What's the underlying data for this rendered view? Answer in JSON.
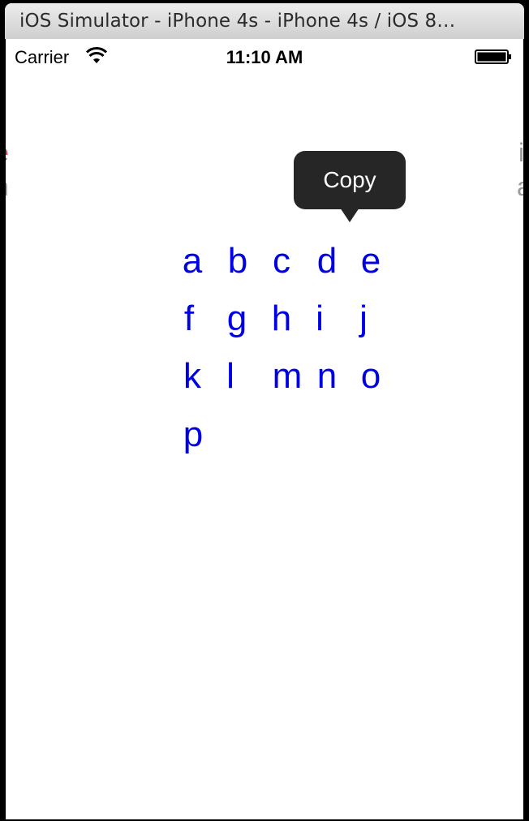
{
  "window": {
    "title": "iOS Simulator - iPhone 4s - iPhone 4s / iOS 8…"
  },
  "status_bar": {
    "carrier": "Carrier",
    "time": "11:10 AM",
    "wifi_icon": "wifi-icon",
    "battery_icon": "battery-icon"
  },
  "edge_fragments": {
    "left_top": "e",
    "left_bottom": "n",
    "right_top": "i",
    "right_bottom": "a",
    "accent_color": "#d9434b",
    "muted_color": "#9a9a9a"
  },
  "menu": {
    "copy_label": "Copy"
  },
  "letters": [
    "a",
    "b",
    "c",
    "d",
    "e",
    "f",
    "g",
    "h",
    "i",
    "j",
    "k",
    "l",
    "m",
    "n",
    "o",
    "p"
  ],
  "colors": {
    "letter_color": "#0000e6",
    "menu_bg": "#262626"
  }
}
